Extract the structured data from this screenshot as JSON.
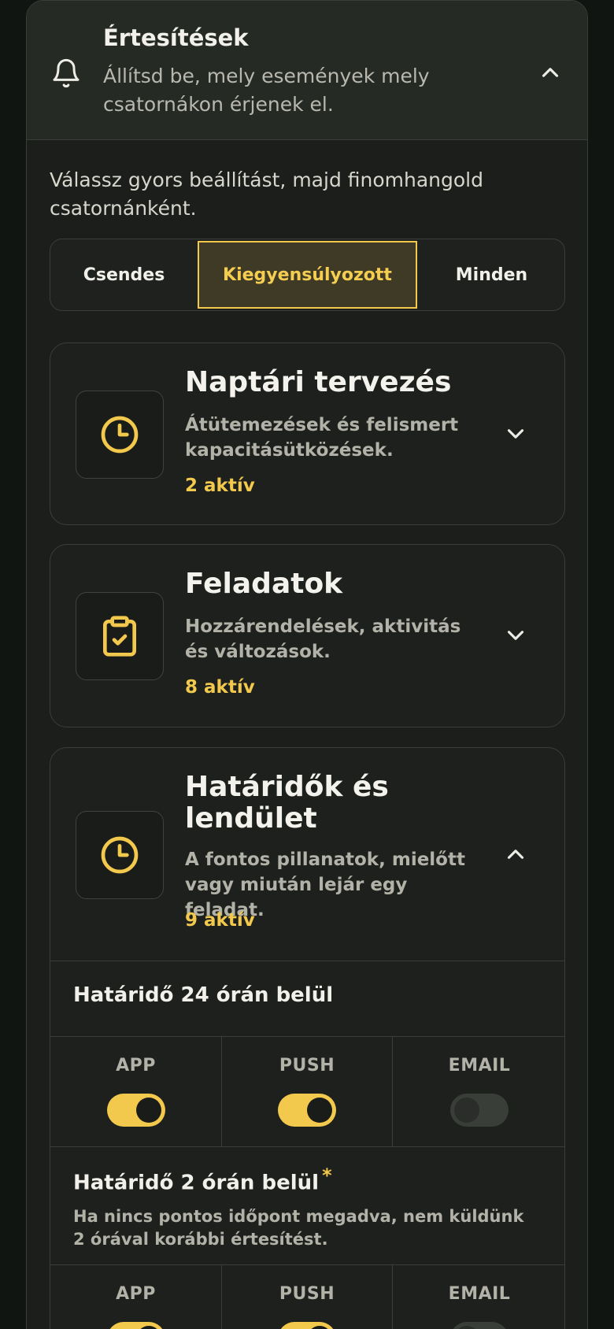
{
  "header": {
    "title": "Értesítések",
    "subtitle": "Állítsd be, mely események mely csatornákon érjenek el.",
    "icon": "bell-icon",
    "expanded": true
  },
  "intro": "Válassz gyors beállítást, majd finomhangold csatornánként.",
  "presets": {
    "options": [
      "Csendes",
      "Kiegyensúlyozott",
      "Minden"
    ],
    "selected": "Kiegyensúlyozott"
  },
  "categories": [
    {
      "title": "Naptári tervezés",
      "description": "Átütemezések és felismert kapacitásütközések.",
      "count": "2 aktív",
      "icon": "clock-icon",
      "expanded": false
    },
    {
      "title": "Feladatok",
      "description": "Hozzárendelések, aktivitás és változások.",
      "count": "8 aktív",
      "icon": "clipboard-check-icon",
      "expanded": false
    },
    {
      "title": "Határidők és lendület",
      "description": "A fontos pillanatok, mielőtt vagy miután lejár egy feladat.",
      "count": "9 aktív",
      "icon": "clock-icon",
      "expanded": true
    }
  ],
  "deadline_rules": [
    {
      "title": "Határidő 24 órán belül",
      "starred": false,
      "note": "",
      "channels": [
        {
          "label": "APP",
          "enabled": true
        },
        {
          "label": "PUSH",
          "enabled": true
        },
        {
          "label": "EMAIL",
          "enabled": false
        }
      ]
    },
    {
      "title": "Határidő 2 órán belül",
      "starred": true,
      "star": "*",
      "note": "Ha nincs pontos időpont megadva, nem küldünk 2 órával korábbi értesítést.",
      "channels": [
        {
          "label": "APP",
          "enabled": true
        },
        {
          "label": "PUSH",
          "enabled": true
        },
        {
          "label": "EMAIL",
          "enabled": false
        }
      ]
    }
  ],
  "colors": {
    "accent": "#f2c94c",
    "background": "#111511",
    "surface": "#1d201c",
    "border": "#3a3e39"
  }
}
